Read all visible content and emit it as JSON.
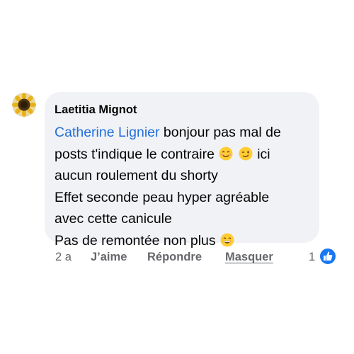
{
  "comment": {
    "author": "Laetitia Mignot",
    "mention": "Catherine Lignier",
    "lines": [
      " bonjour pas mal de",
      "posts t'indique le contraire",
      " ici",
      "aucun roulement du shorty",
      "Effet seconde peau hyper agréable",
      "avec cette canicule",
      "Pas de remontée non plus"
    ],
    "emojis": [
      "smiling-face-icon",
      "winking-face-icon",
      "grinning-face-icon"
    ]
  },
  "actions": {
    "time": "2 a",
    "like": "J’aime",
    "reply": "Répondre",
    "hide": "Masquer",
    "reaction_count": "1"
  },
  "colors": {
    "mention": "#216fdb",
    "bubble": "#f0f2f5",
    "meta": "#65676b",
    "like_badge": "#1877f2"
  }
}
